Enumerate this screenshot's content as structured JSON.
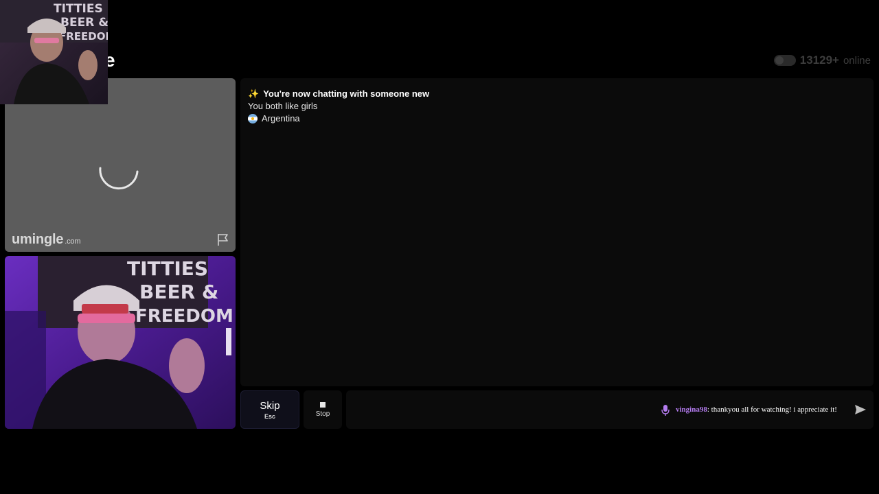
{
  "header": {
    "logo_partial": "e",
    "online_count": "13129+",
    "online_suffix": "online"
  },
  "stranger_video": {
    "brand_name": "umingle",
    "brand_suffix": ".com",
    "report_icon": "flag-icon",
    "loading_icon": "spinner-icon"
  },
  "self_cam": {
    "poster_text": [
      "TITTIES",
      "BEER &",
      "FREEDOM"
    ]
  },
  "chat": {
    "messages": [
      {
        "icon": "sparkles-icon",
        "text": "You're now chatting with someone new"
      },
      {
        "text": "You both like girls"
      },
      {
        "icon": "argentina-flag-icon",
        "text": "Argentina"
      }
    ]
  },
  "controls": {
    "skip_label": "Skip",
    "skip_key": "Esc",
    "stop_label": "Stop",
    "message_placeholder": "",
    "send_icon": "send-icon"
  },
  "stream_overlay": {
    "username": "vingina98",
    "text": ": thankyou all for watching! i appreciate it!",
    "icon": "microphone-icon"
  },
  "colors": {
    "panel_bg": "#0b0b0b",
    "stranger_video_bg": "#5c5c5c",
    "accent_purple": "#b47cf0",
    "skip_bg": "#0f0f1a"
  }
}
